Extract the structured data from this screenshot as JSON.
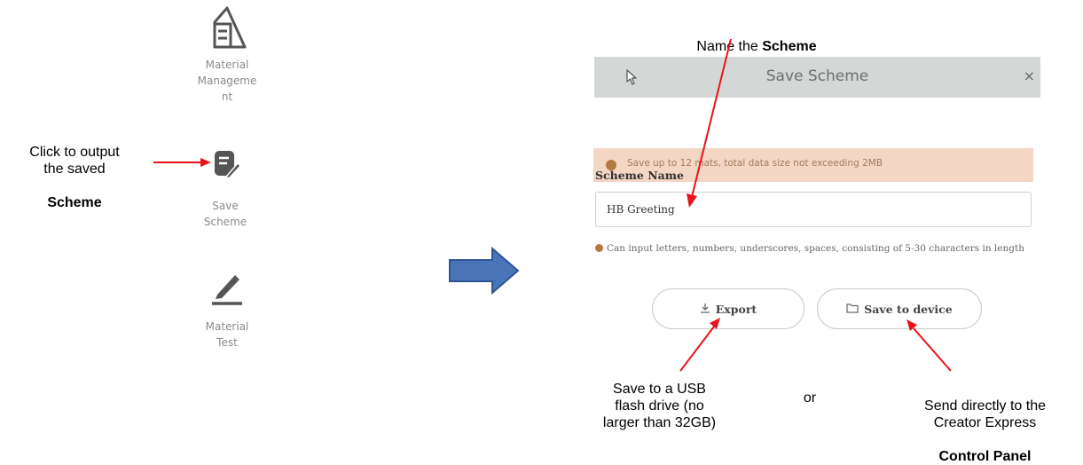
{
  "sidebar": {
    "items": [
      {
        "label": "Material\nManageme\nnt",
        "icon": "material-management-icon"
      },
      {
        "label": "Save\nScheme",
        "icon": "save-scheme-icon"
      },
      {
        "label": "Material\nTest",
        "icon": "material-test-icon"
      }
    ]
  },
  "annotations": {
    "click_to_output": "Click to output\nthe saved",
    "click_to_output_bold": "Scheme",
    "name_the": "Name the ",
    "name_the_bold": "Scheme",
    "usb": "Save to a  USB\nflash drive (no\nlarger than 32GB)",
    "or": "or",
    "send_directly": "Send directly to the\nCreator Express",
    "send_directly_bold": "Control  Panel"
  },
  "dialog": {
    "title": "Save Scheme",
    "close": "×",
    "warning": "Save up to 12 mats, total data size not exceeding 2MB",
    "field_label": "Scheme Name",
    "field_value": "HB Greeting",
    "hint": "Can input letters, numbers, underscores, spaces, consisting of 5-30 characters in length",
    "export_label": "Export",
    "save_device_label": "Save to device"
  },
  "colors": {
    "arrow_red": "#e8141b",
    "big_arrow_blue": "#4a74b8",
    "header_gray": "#d3d8d6",
    "warning_bg": "#f4d6c4"
  }
}
